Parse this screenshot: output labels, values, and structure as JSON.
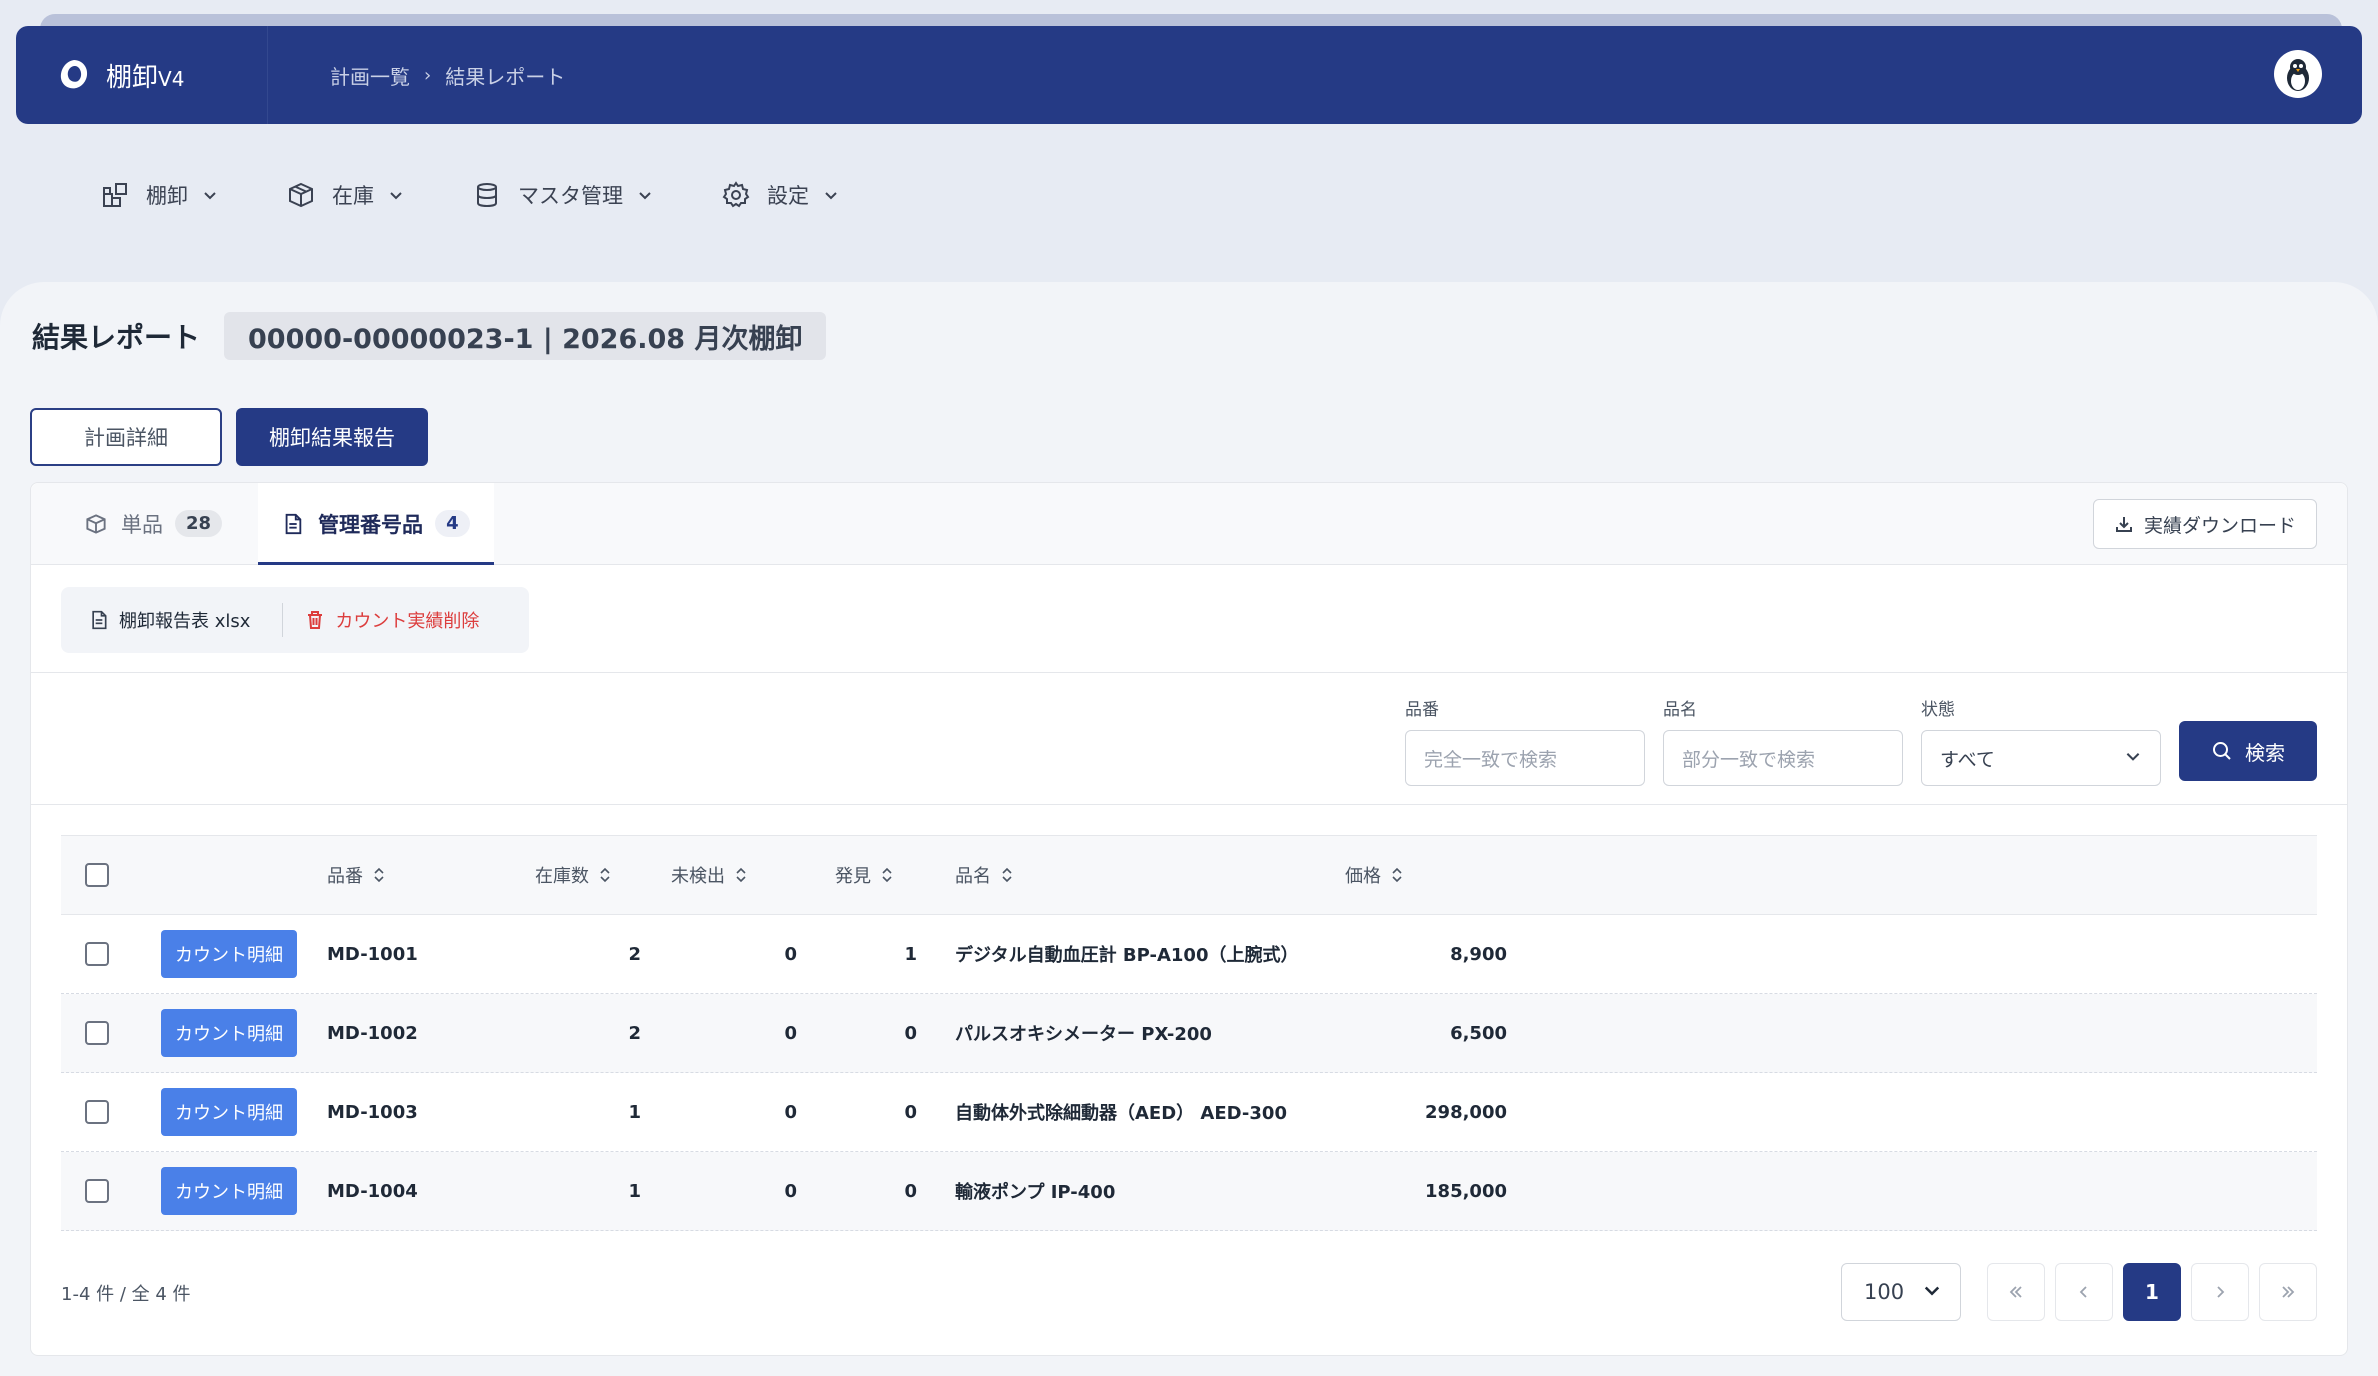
{
  "app": {
    "name": "棚卸",
    "version": "V4"
  },
  "breadcrumb": {
    "items": [
      "計画一覧",
      "結果レポート"
    ],
    "separator": "›"
  },
  "menu": {
    "items": [
      {
        "label": "棚卸",
        "icon": "layout-icon"
      },
      {
        "label": "在庫",
        "icon": "box-icon"
      },
      {
        "label": "マスタ管理",
        "icon": "database-icon"
      },
      {
        "label": "設定",
        "icon": "gear-icon"
      }
    ]
  },
  "page": {
    "title": "結果レポート",
    "plan_label": "00000-00000023-1 | 2026.08 月次棚卸"
  },
  "view_tabs": {
    "detail": "計画詳細",
    "report": "棚卸結果報告"
  },
  "card_tabs": [
    {
      "label": "単品",
      "count": "28",
      "active": false
    },
    {
      "label": "管理番号品",
      "count": "4",
      "active": true
    }
  ],
  "download_label": "実績ダウンロード",
  "actions": {
    "report_xlsx": "棚卸報告表 xlsx",
    "delete_counts": "カウント実績削除"
  },
  "filters": {
    "part_no": {
      "label": "品番",
      "placeholder": "完全一致で検索"
    },
    "name": {
      "label": "品名",
      "placeholder": "部分一致で検索"
    },
    "status": {
      "label": "状態",
      "value": "すべて"
    },
    "search_label": "検索"
  },
  "table": {
    "columns": {
      "part_no": "品番",
      "stock": "在庫数",
      "undetected": "未検出",
      "found": "発見",
      "name": "品名",
      "price": "価格"
    },
    "count_button_label": "カウント明細",
    "rows": [
      {
        "part_no": "MD-1001",
        "stock": "2",
        "undetected": "0",
        "found": "1",
        "name": "デジタル自動血圧計 BP-A100（上腕式）",
        "price": "8,900"
      },
      {
        "part_no": "MD-1002",
        "stock": "2",
        "undetected": "0",
        "found": "0",
        "name": "パルスオキシメーター PX-200",
        "price": "6,500"
      },
      {
        "part_no": "MD-1003",
        "stock": "1",
        "undetected": "0",
        "found": "0",
        "name": "自動体外式除細動器（AED） AED-300",
        "price": "298,000"
      },
      {
        "part_no": "MD-1004",
        "stock": "1",
        "undetected": "0",
        "found": "0",
        "name": "輸液ポンプ IP-400",
        "price": "185,000"
      }
    ]
  },
  "footer": {
    "summary": "1-4 件 / 全 4 件",
    "per_page": "100",
    "current_page": "1"
  },
  "colors": {
    "brand": "#253a85",
    "accent_button": "#4a80e8",
    "danger": "#dc3d3d"
  }
}
